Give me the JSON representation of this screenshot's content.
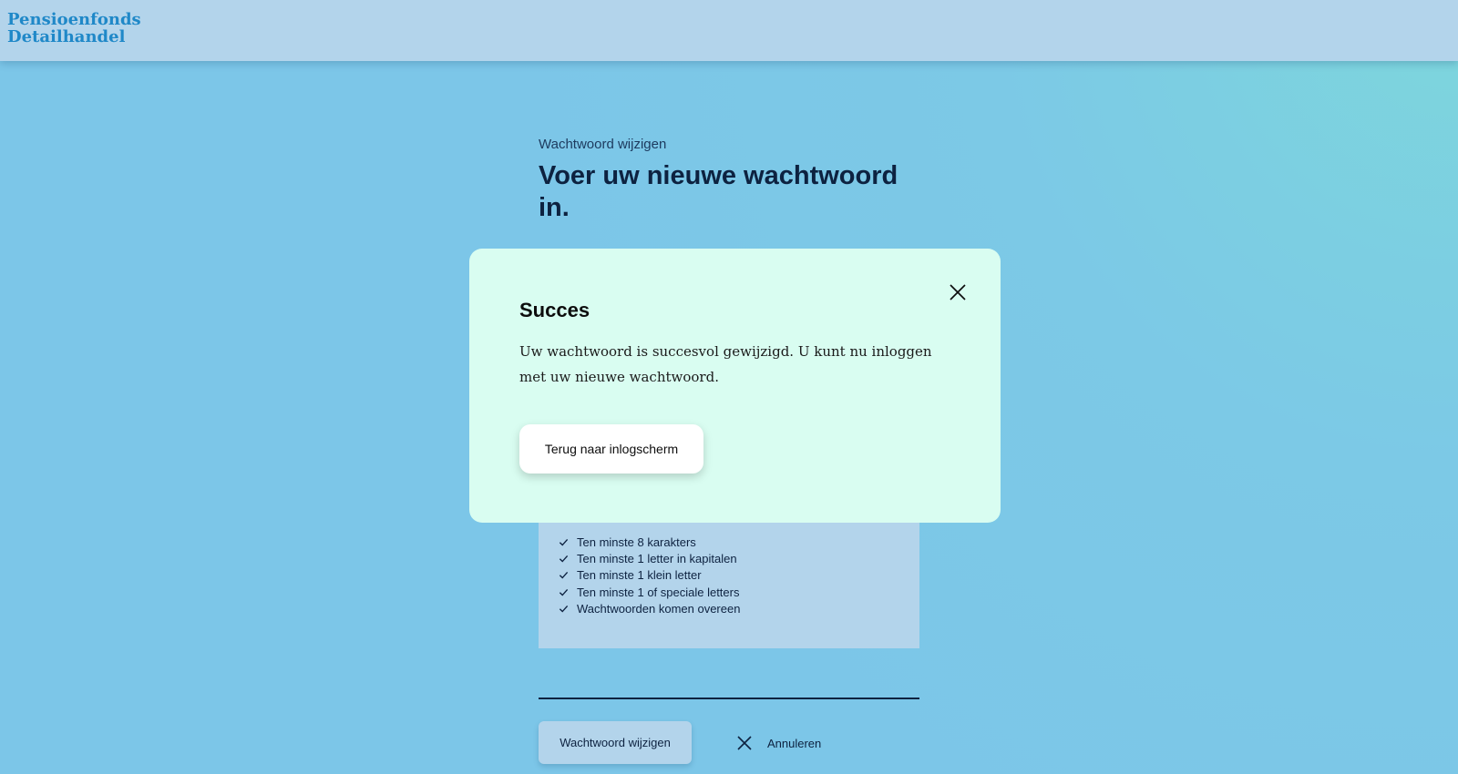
{
  "header": {
    "logo_line1": "Pensioenfonds",
    "logo_line2": "Detailhandel"
  },
  "page": {
    "subtitle": "Wachtwoord wijzigen",
    "heading": "Voer uw nieuwe wachtwoord in."
  },
  "requirements": [
    {
      "label": "Ten minste 8 karakters",
      "icon": "check-icon"
    },
    {
      "label": "Ten minste 1 letter in kapitalen",
      "icon": "check-icon"
    },
    {
      "label": "Ten minste 1 klein letter",
      "icon": "check-icon"
    },
    {
      "label": "Ten minste 1 of speciale letters",
      "icon": "check-icon"
    },
    {
      "label": "Wachtwoorden komen overeen",
      "icon": "check-icon"
    }
  ],
  "actions": {
    "submit_label": "Wachtwoord wijzigen",
    "cancel_label": "Annuleren"
  },
  "modal": {
    "title": "Succes",
    "body": "Uw wachtwoord is succesvol gewijzigd. U kunt nu inloggen met uw nieuwe wachtwoord.",
    "button_label": "Terug naar inlogscherm",
    "close_icon": "close-icon"
  },
  "colors": {
    "background": "#7cc6e8",
    "header_bg": "#b3d4eb",
    "logo": "#1f88c8",
    "modal_bg": "#d9fdf1",
    "text_dark": "#0d2240"
  }
}
